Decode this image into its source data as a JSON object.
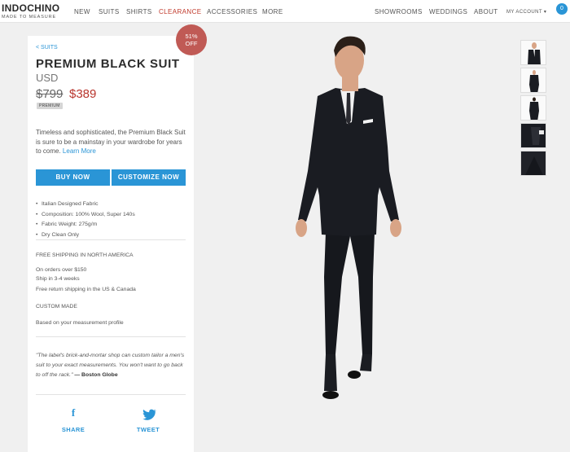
{
  "header": {
    "logo": "INDOCHINO",
    "tagline": "MADE TO MEASURE",
    "nav": [
      "NEW",
      "SUITS",
      "SHIRTS",
      "CLEARANCE",
      "ACCESSORIES",
      "MORE"
    ],
    "right_nav": [
      "SHOWROOMS",
      "WEDDINGS",
      "ABOUT",
      "MY ACCOUNT ▾"
    ],
    "cart_count": "0"
  },
  "product": {
    "breadcrumb": "< SUITS",
    "title": "PREMIUM BLACK SUIT",
    "currency": "USD",
    "old_price": "$799",
    "new_price": "$389",
    "badge": "PREMIUM",
    "discount": "51% OFF",
    "description": "Timeless and sophisticated, the Premium Black Suit is sure to be a mainstay in your wardrobe for years to come.",
    "learn_more": "Learn More",
    "buy_label": "BUY NOW",
    "customize_label": "CUSTOMIZE NOW",
    "features": [
      "Italian Designed Fabric",
      "Composition: 100% Wool, Super 140s",
      "Fabric Weight: 275g/m",
      "Dry Clean Only"
    ],
    "shipping_heading": "FREE SHIPPING IN NORTH AMERICA",
    "shipping_lines": [
      "On orders over $150",
      "Ship in 3-4 weeks",
      "Free return shipping in the US & Canada"
    ],
    "custom_heading": "CUSTOM MADE",
    "custom_line": "Based on your measurement profile",
    "quote": "\"The label's brick-and-mortar shop can custom tailor a men's suit to your exact measurements. You won't want to go back to off the rack.\"",
    "quote_source": "— Boston Globe",
    "share_label": "SHARE",
    "tweet_label": "TWEET"
  },
  "icons": {
    "facebook": "facebook-icon",
    "twitter": "twitter-icon",
    "cart": "cart-icon"
  },
  "colors": {
    "accent": "#2a95d6",
    "sale": "#c0392b",
    "discount_badge": "#c05a55"
  }
}
